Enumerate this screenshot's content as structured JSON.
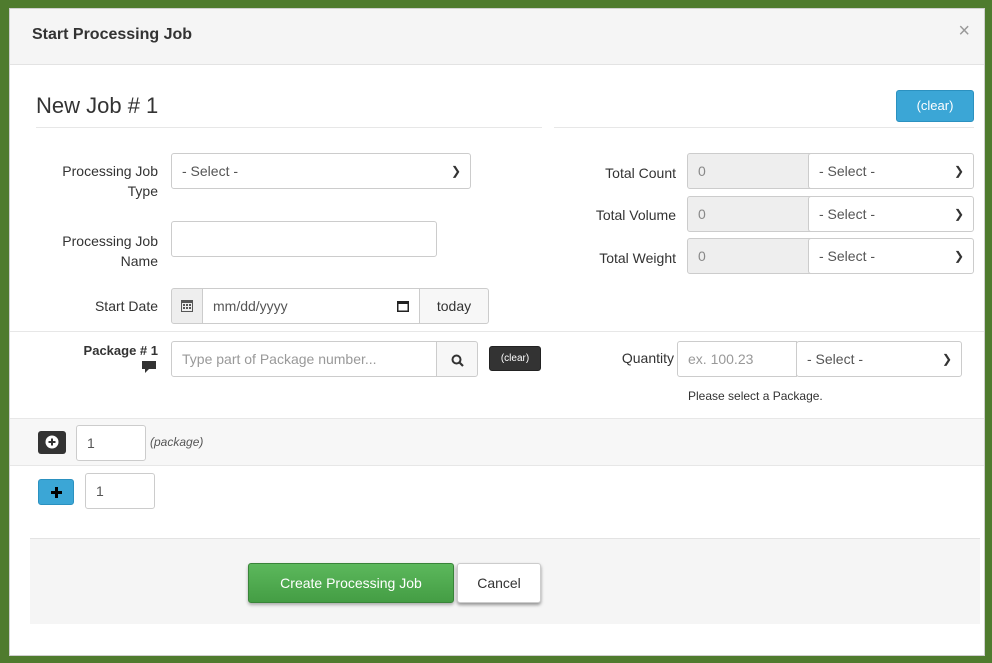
{
  "modal": {
    "title": "Start Processing Job",
    "close": "×"
  },
  "job": {
    "title": "New Job # 1",
    "clear_label": "(clear)"
  },
  "fields": {
    "type_label_1": "Processing Job",
    "type_label_2": "Type",
    "type_select": "- Select -",
    "name_label_1": "Processing Job",
    "name_label_2": "Name",
    "name_value": "",
    "start_date_label": "Start Date",
    "start_date_placeholder": "mm/dd/yyyy",
    "today_label": "today"
  },
  "totals": {
    "count_label": "Total Count",
    "count_value": "0",
    "count_unit": "- Select -",
    "volume_label": "Total Volume",
    "volume_value": "0",
    "volume_unit": "- Select -",
    "weight_label": "Total Weight",
    "weight_value": "0",
    "weight_unit": "- Select -"
  },
  "package": {
    "label": "Package # 1",
    "search_placeholder": "Type part of Package number...",
    "clear_label": "(clear)",
    "quantity_label": "Quantity",
    "quantity_placeholder": "ex. 100.23",
    "quantity_unit": "- Select -",
    "helper": "Please select a Package."
  },
  "add_package": {
    "count": "1",
    "hint": "(package)"
  },
  "add_job": {
    "count": "1"
  },
  "footer": {
    "create_label": "Create Processing Job",
    "cancel_label": "Cancel"
  }
}
